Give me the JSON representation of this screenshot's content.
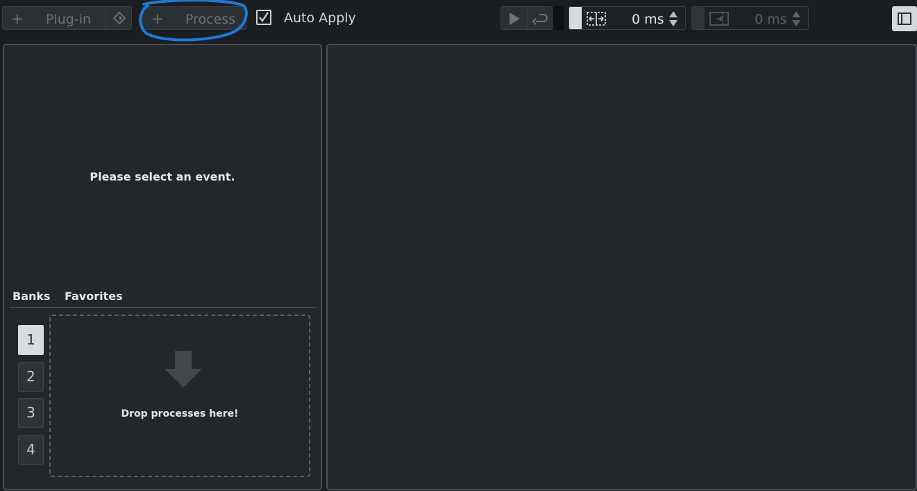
{
  "toolbar": {
    "plugin": {
      "plus": "+",
      "label": "Plug-in"
    },
    "process": {
      "plus": "+",
      "label": "Process"
    },
    "auto_apply_label": "Auto Apply",
    "auto_apply_checked": true,
    "pre_roll": {
      "value": "0 ms"
    },
    "post_roll": {
      "value": "0 ms"
    }
  },
  "left_panel": {
    "empty_message": "Please select an event.",
    "tabs": [
      "Banks",
      "Favorites"
    ],
    "banks": [
      {
        "label": "1",
        "active": true
      },
      {
        "label": "2",
        "active": false
      },
      {
        "label": "3",
        "active": false
      },
      {
        "label": "4",
        "active": false
      }
    ],
    "drop_text": "Drop processes here!"
  },
  "icons": {
    "plugin_settings": "settings-diamond-icon",
    "play": "play-icon",
    "loop": "loop-icon",
    "pre_roll": "pre-roll-icon",
    "post_roll": "post-roll-icon",
    "sidebar": "sidebar-toggle-icon",
    "drop": "drop-arrow-icon"
  },
  "colors": {
    "background": "#1b1e21",
    "panel": "#24272a",
    "annotation": "#1f7ad6"
  }
}
